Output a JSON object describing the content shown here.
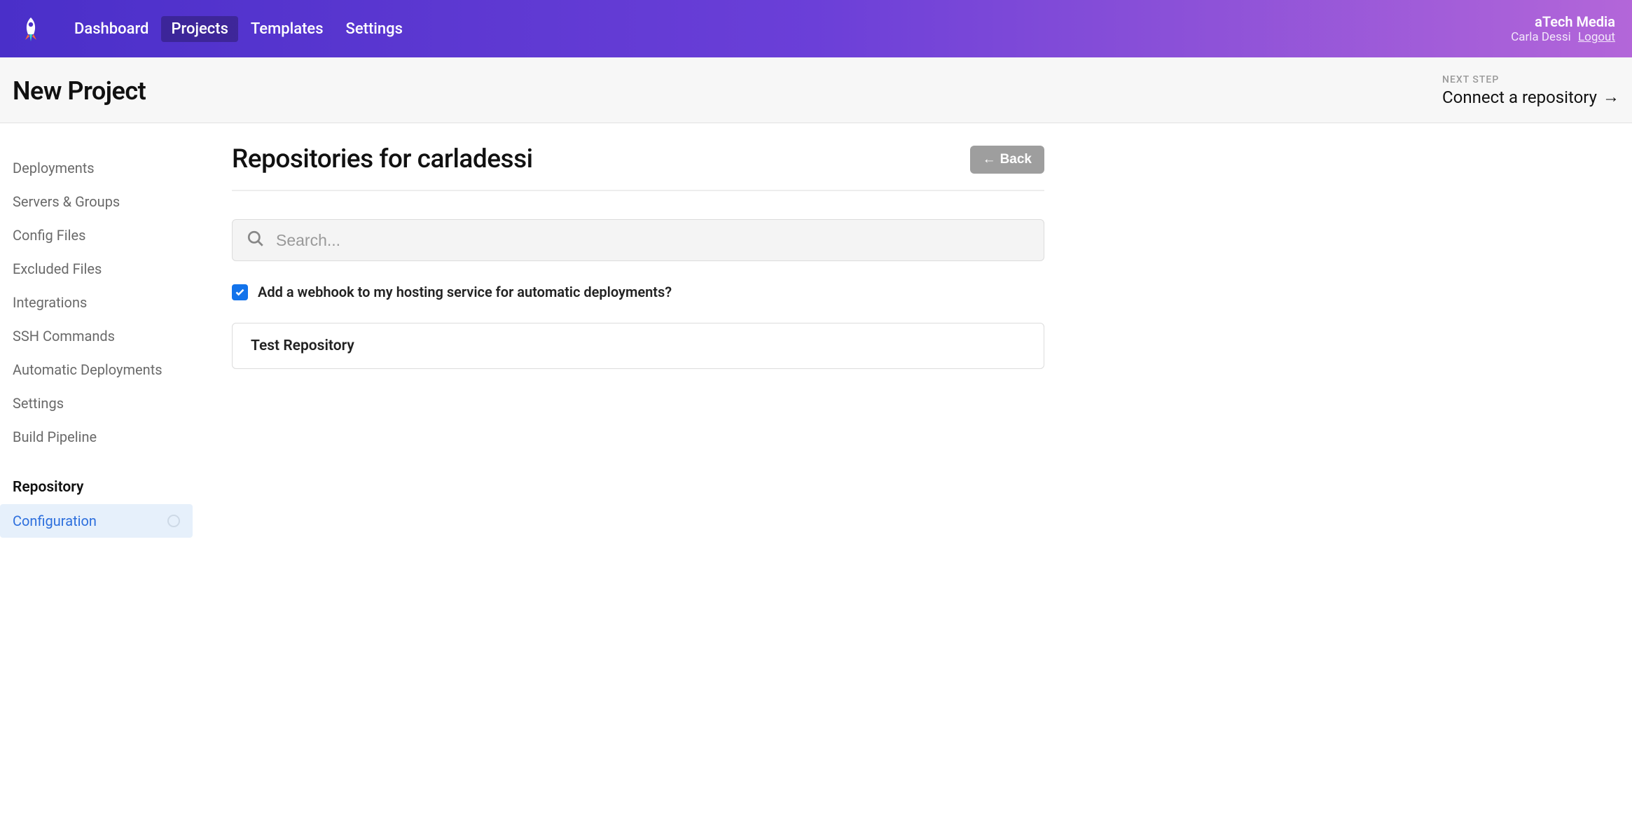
{
  "header": {
    "nav": [
      {
        "label": "Dashboard",
        "active": false
      },
      {
        "label": "Projects",
        "active": true
      },
      {
        "label": "Templates",
        "active": false
      },
      {
        "label": "Settings",
        "active": false
      }
    ],
    "org_name": "aTech Media",
    "user_name": "Carla Dessi",
    "logout_label": "Logout"
  },
  "subheader": {
    "page_title": "New Project",
    "next_step_label": "NEXT STEP",
    "next_step_text": "Connect a repository"
  },
  "sidebar": {
    "items": [
      "Deployments",
      "Servers & Groups",
      "Config Files",
      "Excluded Files",
      "Integrations",
      "SSH Commands",
      "Automatic Deployments",
      "Settings",
      "Build Pipeline"
    ],
    "heading": "Repository",
    "subitem": "Configuration"
  },
  "main": {
    "title": "Repositories for carladessi",
    "back_label": "Back",
    "search_placeholder": "Search...",
    "checkbox_label": "Add a webhook to my hosting service for automatic deployments?",
    "repos": [
      {
        "name": "Test Repository"
      }
    ]
  }
}
